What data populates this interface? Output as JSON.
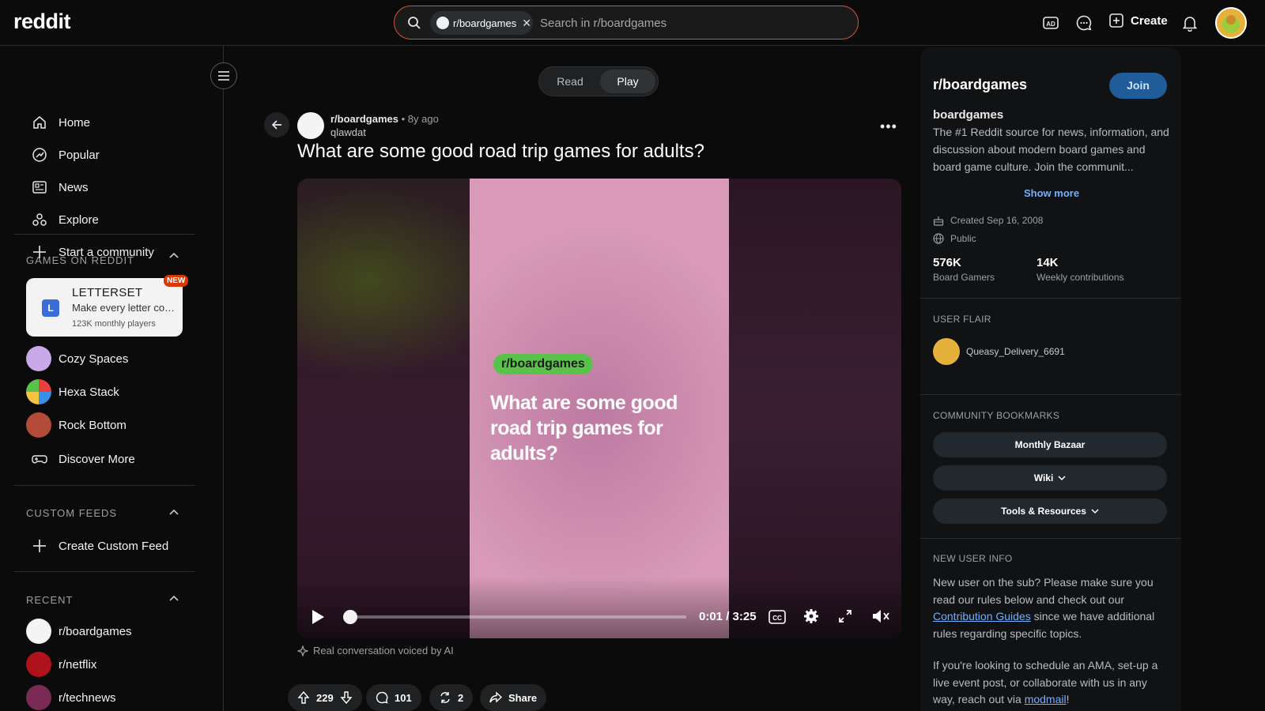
{
  "header": {
    "logo": "reddit",
    "search": {
      "chip_label": "r/boardgames",
      "placeholder": "Search in r/boardgames"
    },
    "create_label": "Create",
    "icons": [
      "ad-icon",
      "chat-icon",
      "create-icon",
      "notification-icon"
    ]
  },
  "sidebar": {
    "nav": [
      {
        "label": "Home",
        "icon": "home-icon"
      },
      {
        "label": "Popular",
        "icon": "popular-icon"
      },
      {
        "label": "News",
        "icon": "news-icon"
      },
      {
        "label": "Explore",
        "icon": "explore-icon"
      },
      {
        "label": "Start a community",
        "icon": "plus-icon"
      }
    ],
    "games_title": "GAMES ON REDDIT",
    "featured_game": {
      "name": "LETTERSET",
      "logo_letter": "L",
      "description": "Make every letter count",
      "players": "123K monthly players",
      "badge": "NEW"
    },
    "games": [
      {
        "label": "Cozy Spaces",
        "color": "#c8a8e8"
      },
      {
        "label": "Hexa Stack",
        "color": "#e8403a"
      },
      {
        "label": "Rock Bottom",
        "color": "#b34b3b"
      },
      {
        "label": "Discover More",
        "icon": "controller-icon"
      }
    ],
    "custom_feeds_title": "CUSTOM FEEDS",
    "create_feed_label": "Create Custom Feed",
    "recent_title": "RECENT",
    "recent": [
      {
        "label": "r/boardgames",
        "color": "#f4f4f4"
      },
      {
        "label": "r/netflix",
        "color": "#b0121b"
      },
      {
        "label": "r/technews",
        "color": "#7a2a55"
      }
    ]
  },
  "post": {
    "mode_toggle": {
      "read": "Read",
      "play": "Play",
      "active": "Play"
    },
    "subreddit": "r/boardgames",
    "age": "• 8y ago",
    "author": "qlawdat",
    "title": "What are some good road trip games for adults?",
    "video": {
      "tag": "r/boardgames",
      "overlay_text": "What are some good road trip games for adults?",
      "time": "0:01 / 3:25",
      "progress": 0.005
    },
    "ai_note": "Real conversation voiced by AI",
    "votes": "229",
    "comments": "101",
    "crossposts": "2",
    "share_label": "Share"
  },
  "community": {
    "title": "r/boardgames",
    "join_label": "Join",
    "name": "boardgames",
    "description": "The #1 Reddit source for news, information, and discussion about modern board games and board game culture. Join the communit...",
    "show_more": "Show more",
    "created": "Created Sep 16, 2008",
    "visibility": "Public",
    "members": "576K",
    "members_label": "Board Gamers",
    "contributions": "14K",
    "contributions_label": "Weekly contributions",
    "user_flair_title": "USER FLAIR",
    "user_flair_name": "Queasy_Delivery_6691",
    "bookmarks_title": "COMMUNITY BOOKMARKS",
    "bookmarks": [
      "Monthly Bazaar",
      "Wiki",
      "Tools & Resources"
    ],
    "new_user_title": "NEW USER INFO",
    "new_user_p1_a": "New user on the sub? Please make sure you read our rules below and check out our ",
    "new_user_p1_link": "Contribution Guides",
    "new_user_p1_b": " since we have additional rules regarding specific topics.",
    "new_user_p2_a": "If you're looking to schedule an AMA, set-up a live event post, or collaborate with us in any way, reach out via ",
    "new_user_p2_link": "modmail",
    "new_user_p2_b": "!"
  },
  "colors": {
    "accent": "#d4513a",
    "join": "#1f5c99",
    "link": "#6fb1ff",
    "tag_green": "#5ac24a",
    "badge": "#d93900"
  }
}
